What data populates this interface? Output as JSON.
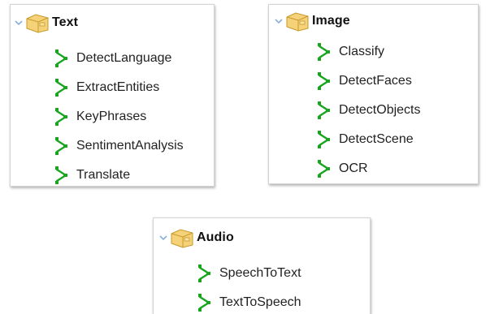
{
  "colors": {
    "folder_fill": "#f5d178",
    "folder_stroke": "#c69a2c",
    "action_green": "#19a51e",
    "chevron": "#7aa6d9"
  },
  "icons": {
    "root": "folder-icon",
    "expand": "chevron-down-icon",
    "child": "green-action-icon"
  },
  "trees": {
    "text": {
      "label": "Text",
      "children": [
        "DetectLanguage",
        "ExtractEntities",
        "KeyPhrases",
        "SentimentAnalysis",
        "Translate"
      ]
    },
    "image": {
      "label": "Image",
      "children": [
        "Classify",
        "DetectFaces",
        "DetectObjects",
        "DetectScene",
        "OCR"
      ]
    },
    "audio": {
      "label": "Audio",
      "children": [
        "SpeechToText",
        "TextToSpeech"
      ]
    }
  }
}
